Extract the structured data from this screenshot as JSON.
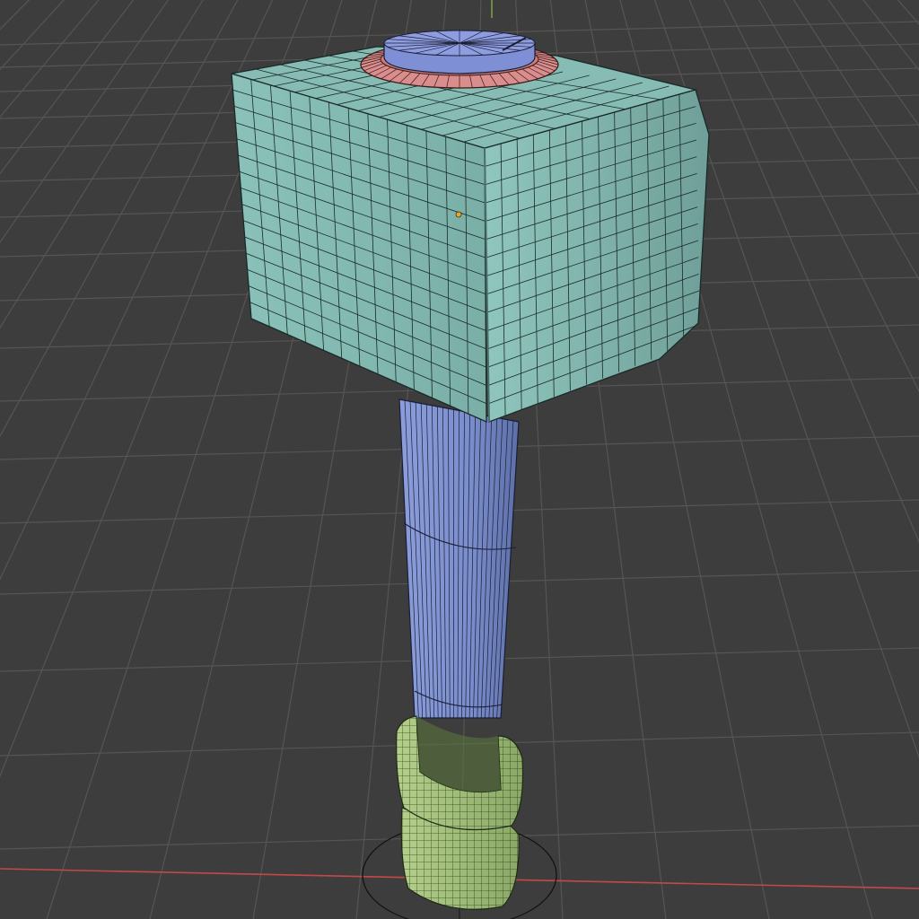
{
  "viewport": {
    "kind": "3d-viewport",
    "background_color": "#3d3d3d",
    "grid_color": "#555555",
    "x_axis_color": "#c44848",
    "y_axis_color": "#8aa84a"
  },
  "model": {
    "head": {
      "color": "#7fb5ad",
      "wire_color": "#1a2a28"
    },
    "top_cap": {
      "color": "#7f8fd6",
      "wire_color": "#1a1e33"
    },
    "top_ring": {
      "color": "#d98d8d",
      "wire_color": "#3a1a1a"
    },
    "handle": {
      "color": "#7f93d0",
      "wire_color": "#1a1e33"
    },
    "grip": {
      "color": "#a6c47d",
      "wire_color": "#1e2a14"
    },
    "origin_color": "#e8a630"
  },
  "cursor_3d": {
    "visible": true
  }
}
